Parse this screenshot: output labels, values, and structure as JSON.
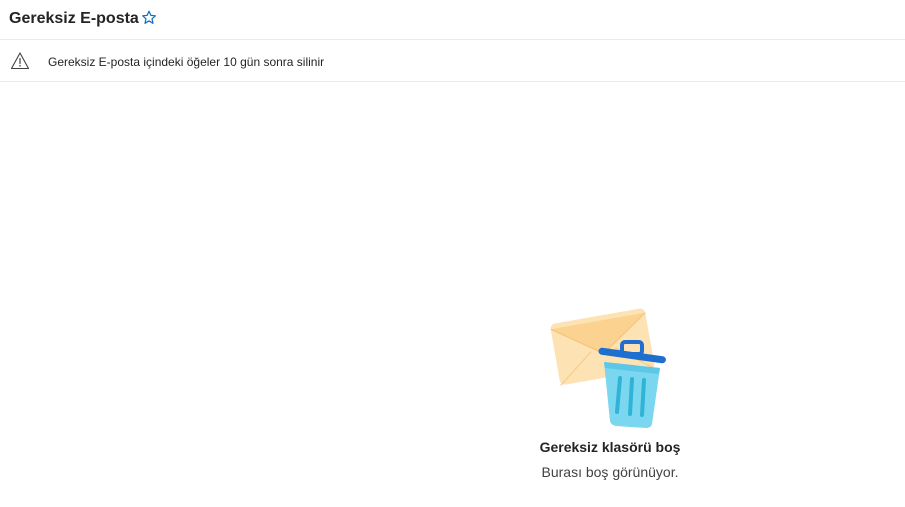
{
  "header": {
    "folder_title": "Gereksiz E-posta",
    "favorite_icon": "star-outline-icon"
  },
  "banner": {
    "icon": "warning-icon",
    "text": "Gereksiz E-posta içindeki öğeler 10 gün sonra silinir"
  },
  "empty_state": {
    "illustration": "envelope-trash-icon",
    "title": "Gereksiz klasörü boş",
    "subtitle": "Burası boş görünüyor."
  },
  "colors": {
    "accent": "#0f6cbd",
    "divider": "#edebe9",
    "text_primary": "#242424",
    "text_secondary": "#424242"
  }
}
